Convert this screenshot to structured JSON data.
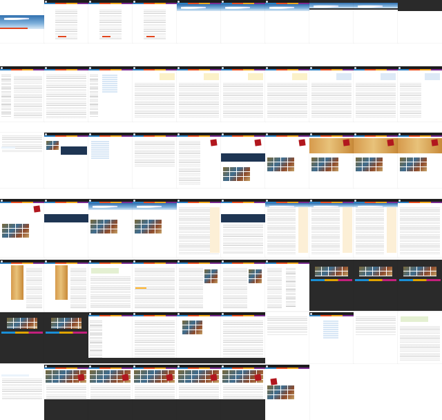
{
  "sheet": {
    "background": "#ffffff",
    "site_colors": {
      "header": "#1c1c1c",
      "accent_blue": "#2d7fc1",
      "accent_orange": "#e74c1d",
      "accent_yellow": "#f2a51a",
      "accent_purple": "#7a2b8f",
      "open_sign": "#b1171e"
    },
    "rows": [
      {
        "kind": "header-strip",
        "cells": [
          "hero-clouds",
          "form-red",
          "form-red",
          "form-red",
          "clouds",
          "clouds",
          "clouds",
          "dark-nav",
          "dark-nav",
          "dark-nav-wide"
        ]
      },
      {
        "kind": "admin-list",
        "cells": [
          "list-columns",
          "list-mixed",
          "table-list",
          "panel-yellow",
          "panel-yellow",
          "panel-yellow",
          "panel-yellow",
          "panel-blue",
          "panel-blue",
          "panel-mixed"
        ]
      },
      {
        "kind": "landing",
        "cells": [
          "login-small",
          "photo-collage",
          "table-panel",
          "plain-text",
          "open-sign",
          "open-sign-navy",
          "open-sign-grid",
          "open-sign-wood",
          "open-sign-wood",
          "open-sign-wood"
        ]
      },
      {
        "kind": "gallery",
        "cells": [
          "open-sign-grid",
          "navy-band",
          "photo-grid",
          "photo-grid",
          "text-columns",
          "text-navy",
          "text-cream",
          "text-cream",
          "text-cream",
          "article"
        ]
      },
      {
        "kind": "media",
        "cells": [
          "poster",
          "poster",
          "green-intro",
          "text-orange",
          "text-photos",
          "text-photos",
          "text-list",
          "dark-photos",
          "dark-photos",
          "dark-photos"
        ]
      },
      {
        "kind": "dark-site",
        "cells": [
          "dark-color",
          "dark-color",
          "list-footer",
          "article-footer",
          "photo-footer",
          "article-footer",
          "white-plain",
          "table-blue",
          "white-plain",
          "green-form"
        ]
      },
      {
        "kind": "final",
        "cells": [
          "blue-form",
          "dark-collage",
          "dark-collage",
          "dark-collage",
          "dark-collage",
          "dark-collage",
          "photo-album"
        ]
      }
    ]
  }
}
